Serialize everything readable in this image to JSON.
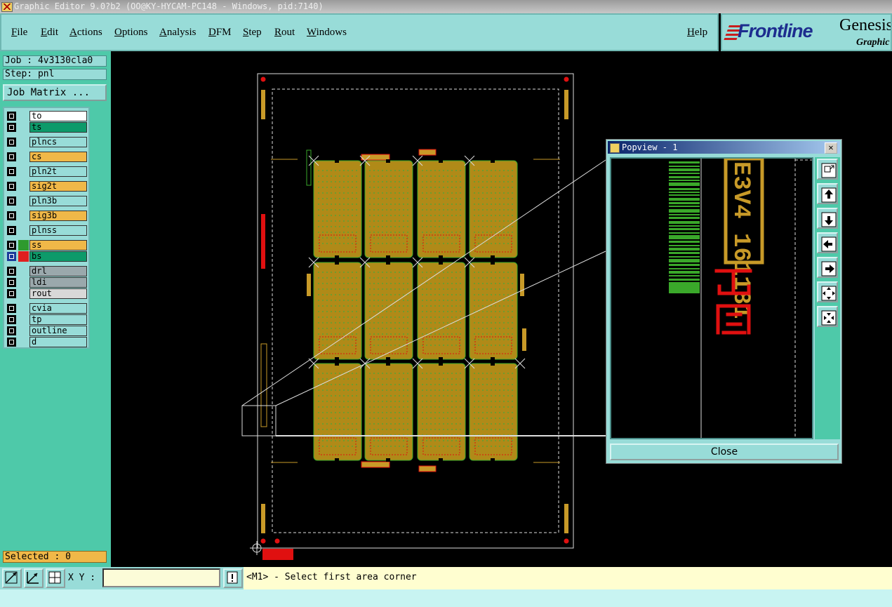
{
  "window": {
    "title": "Graphic Editor 9.0?b2 (OO@KY-HYCAM-PC148 - Windows, pid:7140)"
  },
  "menu": [
    "File",
    "Edit",
    "Actions",
    "Options",
    "Analysis",
    "DFM",
    "Step",
    "Rout",
    "Windows"
  ],
  "help_label": "Help",
  "logo": {
    "brand": "Frontline",
    "product": "Genesis",
    "sub": "Graphic"
  },
  "info": {
    "job": "Job : 4v3130cla0",
    "step": "Step: pnl",
    "job_matrix": "Job Matrix ..."
  },
  "layers": [
    {
      "name": "to",
      "color": "#ffffff"
    },
    {
      "name": "ts",
      "color": "#0d9a6a"
    },
    {
      "name": "plncs",
      "color": "#98dcd8"
    },
    {
      "name": "cs",
      "color": "#f0b848"
    },
    {
      "name": "pln2t",
      "color": "#98dcd8"
    },
    {
      "name": "sig2t",
      "color": "#f0b848"
    },
    {
      "name": "pln3b",
      "color": "#98dcd8"
    },
    {
      "name": "sig3b",
      "color": "#f0b848"
    },
    {
      "name": "plnss",
      "color": "#98dcd8"
    },
    {
      "name": "ss",
      "color": "#f0b848",
      "swatch": "#2e9a2e"
    },
    {
      "name": "bs",
      "color": "#0d9a6a",
      "swatch": "#e02020",
      "active": true
    },
    {
      "name": "drl",
      "color": "#9aa8ac"
    },
    {
      "name": "ldi",
      "color": "#9aa8ac"
    },
    {
      "name": "rout",
      "color": "#d8d8d8"
    },
    {
      "name": "cvia",
      "color": "#98dcd8"
    },
    {
      "name": "tp",
      "color": "#98dcd8"
    },
    {
      "name": "outline",
      "color": "#98dcd8"
    },
    {
      "name": "d",
      "color": "#98dcd8"
    }
  ],
  "selected": "Selected : 0",
  "bottom": {
    "xy_label": "X Y :",
    "xy_value": "",
    "message": "<M1> - Select first area corner"
  },
  "popview": {
    "title": "Popview - 1",
    "close_label": "Close",
    "marking_text": "E3V4 161181"
  }
}
